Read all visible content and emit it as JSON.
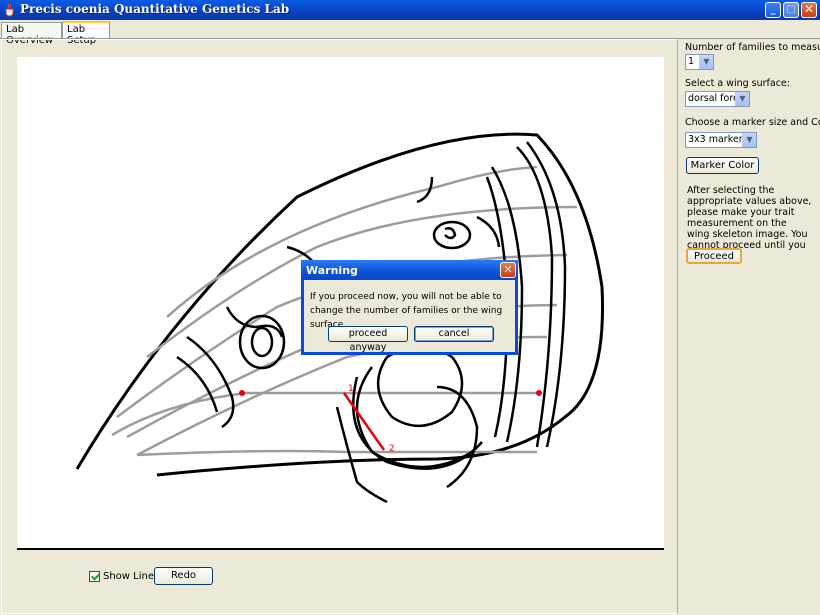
{
  "window": {
    "title": "Precis coenia Quantitative Genetics Lab",
    "min_label": "_",
    "max_label": "□",
    "close_label": "✕"
  },
  "tabs": [
    {
      "label": "Lab Overview",
      "active": false
    },
    {
      "label": "Lab Setup",
      "active": true
    }
  ],
  "canvas": {
    "markers": [
      {
        "label": "1"
      },
      {
        "label": "2"
      }
    ],
    "line_color": "#e8000f"
  },
  "bottom": {
    "show_line_label": "Show Line",
    "show_line_checked": true,
    "redo_label": "Redo"
  },
  "sidebar": {
    "families_label": "Number of families to measure:",
    "families_value": "1",
    "surface_label": "Select a wing surface:",
    "surface_value": "dorsal fore",
    "marker_label": "Choose a marker size and Color",
    "marker_value": "3x3 marker",
    "marker_color_label": "Marker Color",
    "info_text": "After selecting the appropriate values above, please make your trait measurement on the  wing skeleton image.  You cannot proceed until you do.",
    "proceed_label": "Proceed"
  },
  "dialog": {
    "title": "Warning",
    "message": "If you proceed now, you will not be able to change the number of families or the wing surface.",
    "proceed_anyway_label": "proceed anyway",
    "cancel_label": "cancel",
    "close_label": "✕"
  },
  "colors": {
    "titlebar": "#0a4ad0",
    "accent_tab": "#ffc83c",
    "wing_veins": "#a09b9b"
  }
}
